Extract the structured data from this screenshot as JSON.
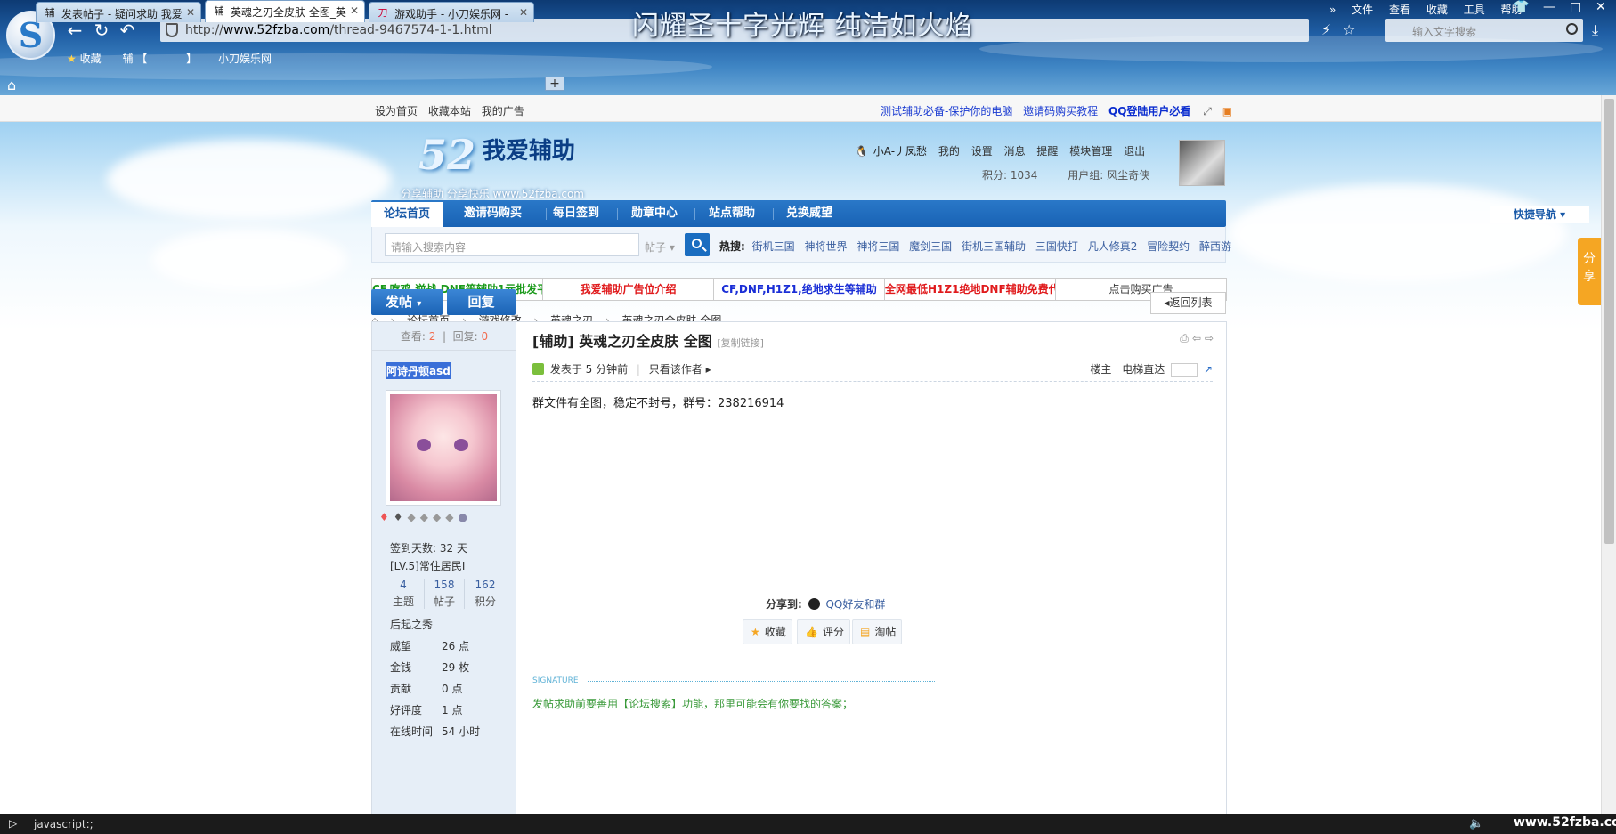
{
  "browser": {
    "url_prefix": "http://",
    "url_domain": "www.52fzba.com",
    "url_path": "/thread-9467574-1-1.html",
    "banner_title": "闪耀圣十字光辉 纯洁如火焰",
    "search_placeholder": "输入文字搜索",
    "menu": [
      "文件",
      "查看",
      "收藏",
      "工具",
      "帮助"
    ],
    "bookmarks": [
      "收藏",
      "辅 【",
      "】",
      "小刀娱乐网"
    ],
    "tabs": [
      {
        "label": "发表帖子 - 疑问求助 我爱",
        "favicon": "辅"
      },
      {
        "label": "英魂之刃全皮肤 全图_英",
        "favicon": "辅"
      },
      {
        "label": "游戏助手 - 小刀娱乐网 - ",
        "favicon": "刀"
      }
    ],
    "newtab_label": "+",
    "status_text": "javascript:;",
    "watermark": "www.52fzba.com"
  },
  "strip": {
    "left": [
      "设为首页",
      "收藏本站",
      "我的广告"
    ],
    "right": [
      "测试辅助必备-保护你的电脑",
      "邀请码购买教程"
    ],
    "right_bold": "QQ登陆用户必看"
  },
  "site": {
    "logo_num": "52",
    "logo_name": "我爱辅助",
    "slogan": "分享辅助  分享快乐  www.52fzba.com",
    "user": {
      "name": "小A-丿凤愁",
      "links": [
        "我的",
        "设置",
        "消息",
        "提醒",
        "模块管理",
        "退出"
      ],
      "points": "积分: 1034",
      "group": "用户组: 风尘奇侠"
    },
    "nav": [
      "论坛首页",
      "邀请码购买",
      "每日签到",
      "勋章中心",
      "站点帮助",
      "兑换威望"
    ],
    "quicknav": "快捷导航",
    "search_placeholder": "请输入搜索内容",
    "search_type": "帖子",
    "hot_label": "热搜:",
    "hot": [
      "街机三国",
      "神将世界",
      "神将三国",
      "魔剑三国",
      "街机三国辅助",
      "三国快打",
      "凡人修真2",
      "冒险契约",
      "醉西游"
    ],
    "ads": [
      {
        "text": "CF,吃鸡,逆战,DNF等辅助1元批发平",
        "color": "#1b9a1b"
      },
      {
        "text": "我爱辅助广告位介绍",
        "color": "#e0191b"
      },
      {
        "text": "CF,DNF,H1Z1,绝地求生等辅助",
        "color": "#1a2ed6"
      },
      {
        "text": "全网最低H1Z1绝地DNF辅助免费代",
        "color": "#e0191b"
      },
      {
        "text": "点击购买广告",
        "color": "#333333"
      }
    ],
    "breadcrumb": [
      "论坛首页",
      "游戏修改",
      "英魂之刃",
      "英魂之刃全皮肤 全图"
    ],
    "btn_post": "发帖",
    "btn_reply": "回复",
    "btn_back": "返回列表"
  },
  "post": {
    "views_label": "查看:",
    "views": "2",
    "replies_label": "回复:",
    "replies": "0",
    "author": "阿诗丹顿asd",
    "signin_days": "签到天数: 32 天",
    "level": "[LV.5]常住居民I",
    "counts": [
      {
        "value": "4",
        "label": "主题"
      },
      {
        "value": "158",
        "label": "帖子"
      },
      {
        "value": "162",
        "label": "积分"
      }
    ],
    "rank": "后起之秀",
    "stats": [
      {
        "k": "威望",
        "v": "26 点"
      },
      {
        "k": "金钱",
        "v": "29 枚"
      },
      {
        "k": "贡献",
        "v": "0 点"
      },
      {
        "k": "好评度",
        "v": "1 点"
      },
      {
        "k": "在线时间",
        "v": "54 小时"
      }
    ],
    "title": "[辅助] 英魂之刃全皮肤 全图",
    "copy_link": "[复制链接]",
    "posted": "发表于 5 分钟前",
    "only_author": "只看该作者",
    "floor_owner": "楼主",
    "elevator": "电梯直达",
    "body": "群文件有全图，稳定不封号，群号：238216914",
    "share_label": "分享到:",
    "share_target": "QQ好友和群",
    "actions": [
      "收藏",
      "评分",
      "淘帖"
    ],
    "signature_label": "SIGNATURE",
    "signature_text": "发帖求助前要善用【论坛搜索】功能，那里可能会有你要找的答案；"
  },
  "float_share": "分享"
}
